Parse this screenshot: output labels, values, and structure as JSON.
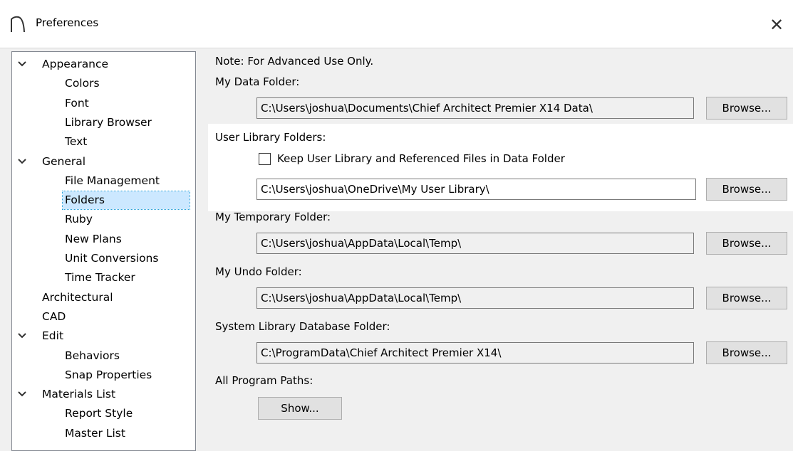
{
  "window": {
    "title": "Preferences",
    "close_glyph": "✕",
    "icon": "chief-architect-logo-icon"
  },
  "tree": {
    "items": [
      {
        "label": "Appearance",
        "level": 1,
        "expanded": true
      },
      {
        "label": "Colors",
        "level": 2
      },
      {
        "label": "Font",
        "level": 2
      },
      {
        "label": "Library Browser",
        "level": 2
      },
      {
        "label": "Text",
        "level": 2
      },
      {
        "label": "General",
        "level": 1,
        "expanded": true
      },
      {
        "label": "File Management",
        "level": 2
      },
      {
        "label": "Folders",
        "level": 2,
        "selected": true
      },
      {
        "label": "Ruby",
        "level": 2
      },
      {
        "label": "New Plans",
        "level": 2
      },
      {
        "label": "Unit Conversions",
        "level": 2
      },
      {
        "label": "Time Tracker",
        "level": 2
      },
      {
        "label": "Architectural",
        "level": 1
      },
      {
        "label": "CAD",
        "level": 1
      },
      {
        "label": "Edit",
        "level": 1,
        "expanded": true
      },
      {
        "label": "Behaviors",
        "level": 2
      },
      {
        "label": "Snap Properties",
        "level": 2
      },
      {
        "label": "Materials List",
        "level": 1,
        "expanded": true
      },
      {
        "label": "Report Style",
        "level": 2
      },
      {
        "label": "Master List",
        "level": 2
      }
    ]
  },
  "folders": {
    "note": "Note: For Advanced Use Only.",
    "data_label": "My Data Folder:",
    "data_path": "C:\\Users\\joshua\\Documents\\Chief Architect Premier X14 Data\\",
    "user_lib_label": "User Library Folders:",
    "keep_checkbox_label": "Keep User Library and Referenced Files in Data Folder",
    "keep_checked": false,
    "user_lib_path": "C:\\Users\\joshua\\OneDrive\\My User Library\\",
    "temp_label": "My Temporary Folder:",
    "temp_path": "C:\\Users\\joshua\\AppData\\Local\\Temp\\",
    "undo_label": "My Undo Folder:",
    "undo_path": "C:\\Users\\joshua\\AppData\\Local\\Temp\\",
    "syslib_label": "System Library Database Folder:",
    "syslib_path": "C:\\ProgramData\\Chief Architect Premier X14\\",
    "all_paths_label": "All Program Paths:",
    "browse_label": "Browse...",
    "show_label": "Show..."
  },
  "colors": {
    "highlight": "#ffffff",
    "selection": "#cce8ff",
    "background": "#f0f0f0"
  }
}
